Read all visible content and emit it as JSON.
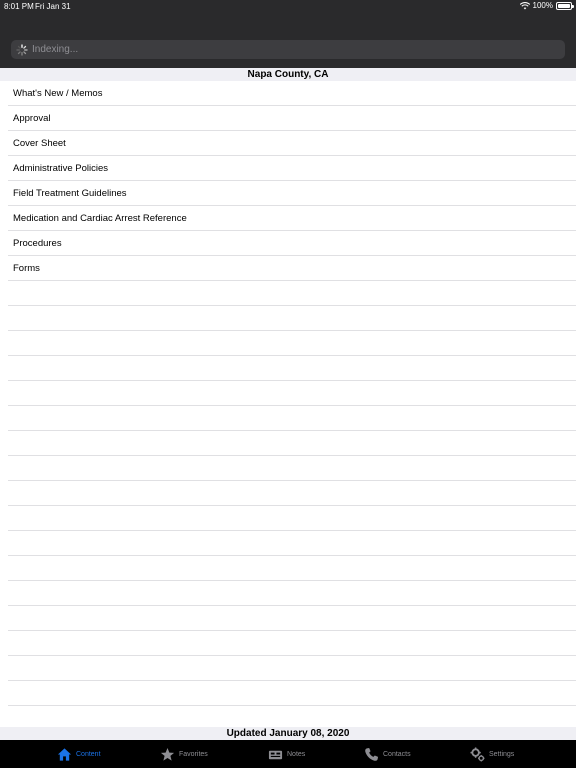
{
  "status_bar": {
    "time": "8:01 PM",
    "date": "Fri Jan 31",
    "battery": "100%"
  },
  "search": {
    "placeholder": "Indexing..."
  },
  "header": {
    "title": "Napa County, CA"
  },
  "items": [
    {
      "label": "What's New / Memos"
    },
    {
      "label": "Approval"
    },
    {
      "label": "Cover Sheet"
    },
    {
      "label": "Administrative Policies"
    },
    {
      "label": "Field Treatment Guidelines"
    },
    {
      "label": "Medication and Cardiac Arrest Reference"
    },
    {
      "label": "Procedures"
    },
    {
      "label": "Forms"
    }
  ],
  "footer": {
    "updated": "Updated January 08, 2020"
  },
  "tabs": [
    {
      "label": "Content",
      "icon": "home-icon",
      "active": true
    },
    {
      "label": "Favorites",
      "icon": "star-icon",
      "active": false
    },
    {
      "label": "Notes",
      "icon": "notes-icon",
      "active": false
    },
    {
      "label": "Contacts",
      "icon": "phone-icon",
      "active": false
    },
    {
      "label": "Settings",
      "icon": "gear-icon",
      "active": false
    }
  ],
  "colors": {
    "accent": "#1a73e8",
    "topbar": "#2a2a2c",
    "tabbar": "#000000"
  }
}
